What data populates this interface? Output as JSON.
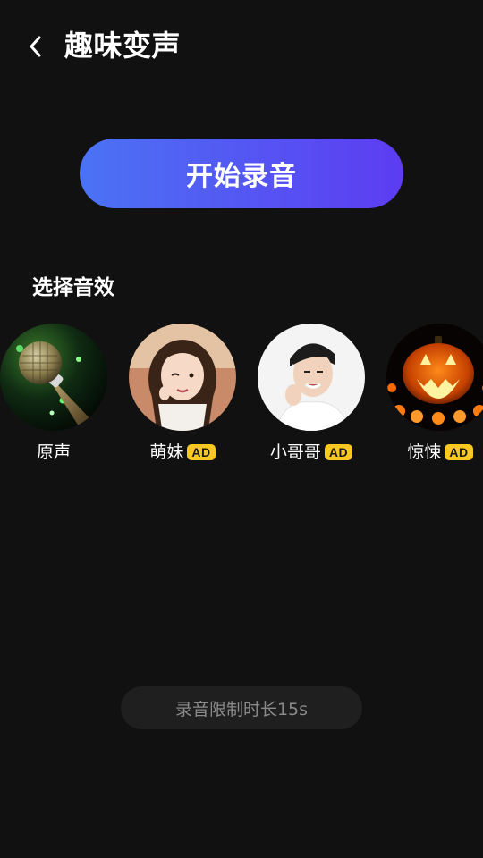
{
  "header": {
    "back_icon": "chevron-left-icon",
    "title": "趣味变声"
  },
  "record_button": {
    "label": "开始录音",
    "gradient": [
      "#4b73f4",
      "#5d3cf2"
    ]
  },
  "effects_section": {
    "title": "选择音效",
    "items": [
      {
        "label": "原声",
        "image": "microphone-image",
        "ad": ""
      },
      {
        "label": "萌妹",
        "image": "girl-portrait-image",
        "ad": "AD"
      },
      {
        "label": "小哥哥",
        "image": "boy-portrait-image",
        "ad": "AD"
      },
      {
        "label": "惊悚",
        "image": "pumpkin-image",
        "ad": "AD"
      }
    ]
  },
  "limit_notice": {
    "text": "录音限制时长15s"
  },
  "colors": {
    "background": "#111111",
    "ad_badge": "#f9c823",
    "pill_bg": "#1f1f1f"
  }
}
